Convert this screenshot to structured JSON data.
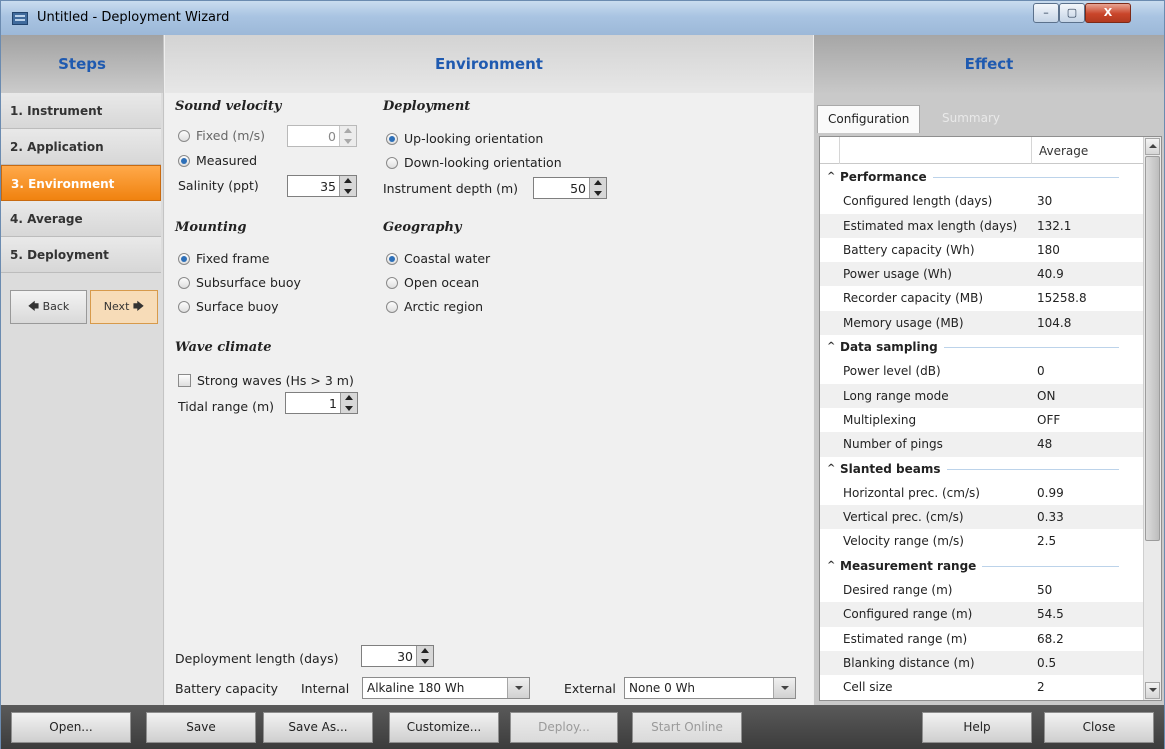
{
  "window": {
    "title": "Untitled - Deployment Wizard",
    "controls": {
      "minimize": "–",
      "maximize": "▢",
      "close": "X"
    }
  },
  "steps": {
    "header": "Steps",
    "items": [
      {
        "label": "1. Instrument",
        "active": false
      },
      {
        "label": "2. Application",
        "active": false
      },
      {
        "label": "3. Environment",
        "active": true
      },
      {
        "label": "4. Average",
        "active": false
      },
      {
        "label": "5. Deployment",
        "active": false
      }
    ],
    "back_label": "🡄 Back",
    "next_label": "Next 🡆"
  },
  "environment": {
    "header": "Environment",
    "sound_velocity": {
      "title": "Sound velocity",
      "fixed_label": "Fixed (m/s)",
      "fixed_value": "0",
      "measured_label": "Measured",
      "selected": "Measured",
      "salinity_label": "Salinity (ppt)",
      "salinity_value": "35"
    },
    "deployment": {
      "title": "Deployment",
      "up_label": "Up-looking orientation",
      "down_label": "Down-looking orientation",
      "selected": "Up-looking orientation",
      "depth_label": "Instrument depth (m)",
      "depth_value": "50"
    },
    "mounting": {
      "title": "Mounting",
      "options": [
        "Fixed frame",
        "Subsurface buoy",
        "Surface buoy"
      ],
      "selected": "Fixed frame"
    },
    "geography": {
      "title": "Geography",
      "options": [
        "Coastal water",
        "Open ocean",
        "Arctic region"
      ],
      "selected": "Coastal water"
    },
    "wave_climate": {
      "title": "Wave climate",
      "strong_waves_label": "Strong waves (Hs > 3 m)",
      "strong_waves_checked": false,
      "tidal_label": "Tidal range (m)",
      "tidal_value": "1"
    },
    "deployment_length_label": "Deployment length (days)",
    "deployment_length_value": "30",
    "battery_capacity_label": "Battery capacity",
    "internal_label": "Internal",
    "internal_value": "Alkaline 180 Wh",
    "external_label": "External",
    "external_value": "None 0 Wh"
  },
  "effect": {
    "header": "Effect",
    "tabs": [
      "Configuration",
      "Summary"
    ],
    "active_tab": "Configuration",
    "column_header": "Average",
    "groups": [
      {
        "name": "Performance",
        "rows": [
          [
            "Configured length (days)",
            "30"
          ],
          [
            "Estimated max length (days)",
            "132.1"
          ],
          [
            "Battery capacity (Wh)",
            "180"
          ],
          [
            "Power usage (Wh)",
            "40.9"
          ],
          [
            "Recorder capacity (MB)",
            "15258.8"
          ],
          [
            "Memory usage (MB)",
            "104.8"
          ]
        ]
      },
      {
        "name": "Data sampling",
        "rows": [
          [
            "Power level (dB)",
            "0"
          ],
          [
            "Long range mode",
            "ON"
          ],
          [
            "Multiplexing",
            "OFF"
          ],
          [
            "Number of pings",
            "48"
          ]
        ]
      },
      {
        "name": "Slanted beams",
        "rows": [
          [
            "Horizontal prec. (cm/s)",
            "0.99"
          ],
          [
            "Vertical prec. (cm/s)",
            "0.33"
          ],
          [
            "Velocity range (m/s)",
            "2.5"
          ]
        ]
      },
      {
        "name": "Measurement range",
        "rows": [
          [
            "Desired range (m)",
            "50"
          ],
          [
            "Configured range (m)",
            "54.5"
          ],
          [
            "Estimated range (m)",
            "68.2"
          ],
          [
            "Blanking distance (m)",
            "0.5"
          ],
          [
            "Cell size",
            "2"
          ]
        ]
      }
    ]
  },
  "bottom_bar": {
    "open": "Open...",
    "save": "Save",
    "save_as": "Save As...",
    "customize": "Customize...",
    "deploy": "Deploy...",
    "start_online": "Start Online",
    "help": "Help",
    "close": "Close"
  },
  "colors": {
    "accent_blue": "#1f5ab0",
    "active_step": "#f0820f"
  }
}
